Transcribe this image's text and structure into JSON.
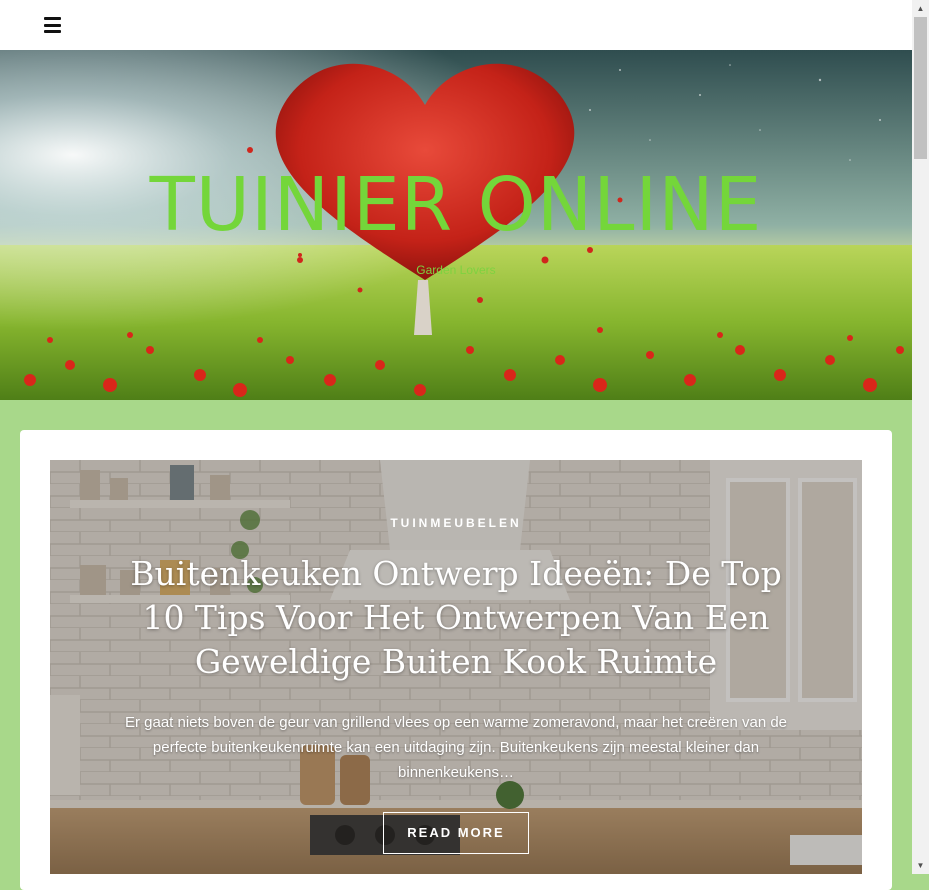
{
  "header": {
    "menu_icon": "hamburger-menu-icon"
  },
  "hero": {
    "site_title": "TUINIER ONLINE",
    "tagline": "Garden Lovers",
    "title_color": "#74d63a"
  },
  "post": {
    "category": "TUINMEUBELEN",
    "title": "Buitenkeuken Ontwerp Ideeën: De Top 10 Tips Voor Het Ontwerpen Van Een Geweldige Buiten Kook Ruimte",
    "excerpt": "Er gaat niets boven de geur van grillend vlees op een warme zomeravond, maar het creëren van de perfecte buitenkeukenruimte kan een uitdaging zijn. Buitenkeukens zijn meestal kleiner dan binnenkeukens…",
    "read_more": "READ MORE"
  },
  "colors": {
    "page_background": "#a8d88a",
    "accent_green": "#74d63a"
  },
  "scrollbar": {
    "up_icon": "chevron-up-icon",
    "down_icon": "chevron-down-icon"
  }
}
